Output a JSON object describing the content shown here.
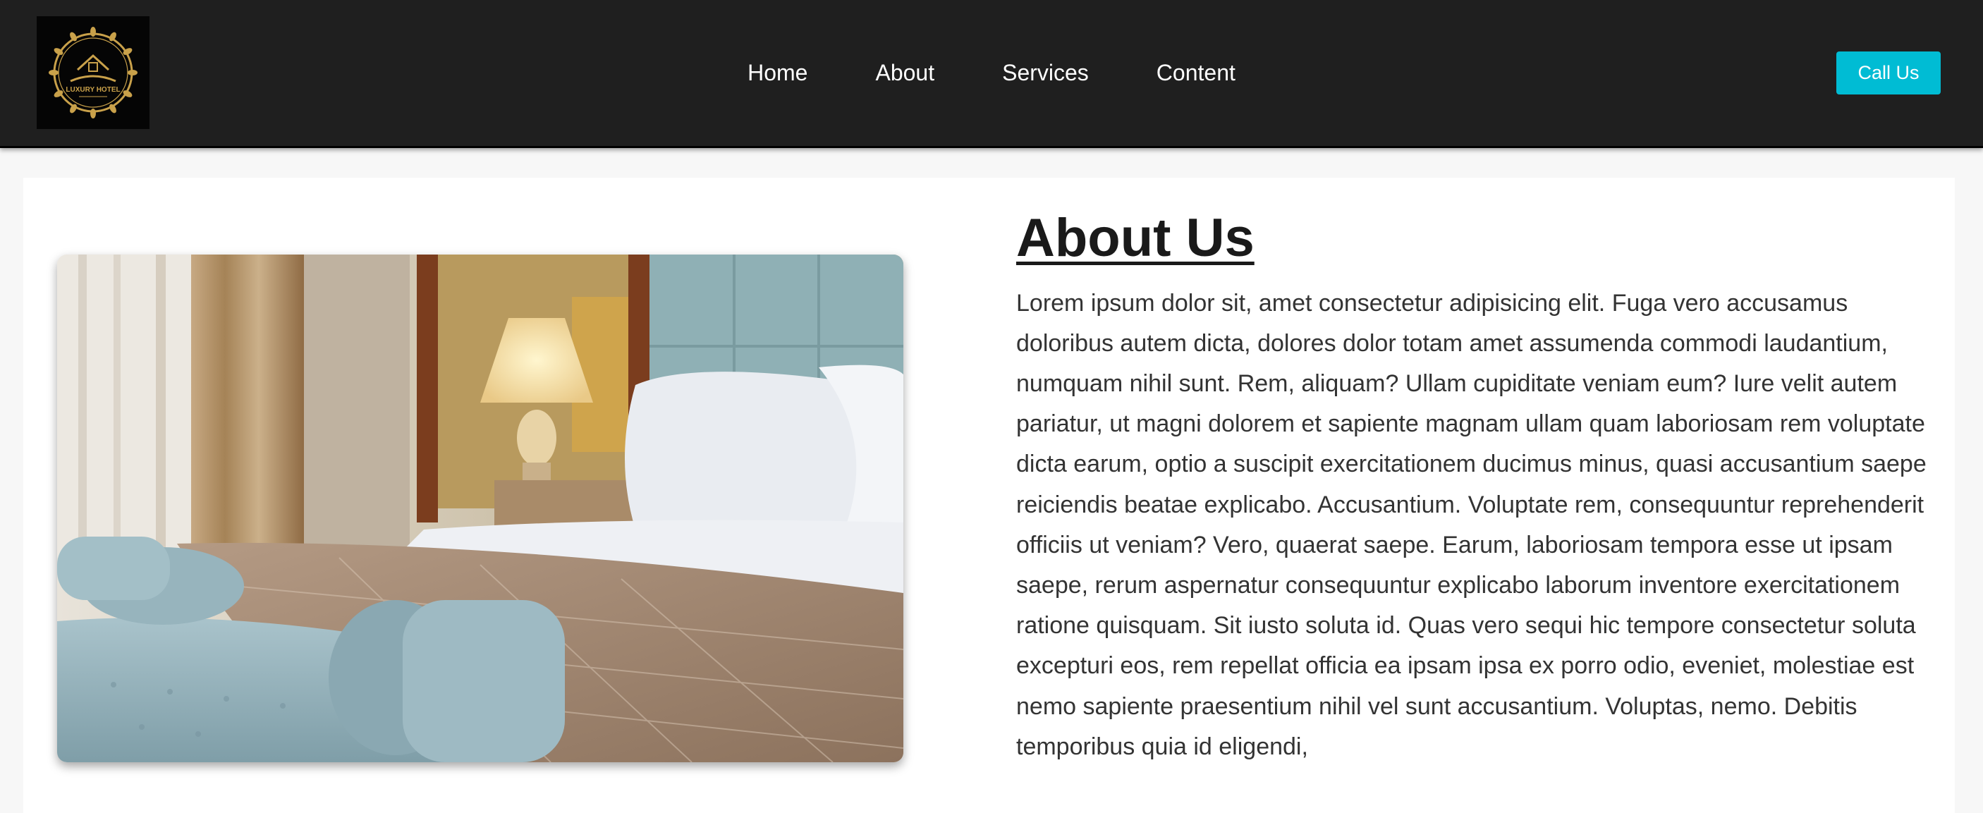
{
  "brand": {
    "logo_text": "LUXURY HOTEL",
    "logo_icon": "house-wreath-icon"
  },
  "nav": {
    "items": [
      {
        "label": "Home"
      },
      {
        "label": "About"
      },
      {
        "label": "Services"
      },
      {
        "label": "Content"
      }
    ],
    "call_button": "Call Us"
  },
  "about": {
    "title": "About Us",
    "body": "Lorem ipsum dolor sit, amet consectetur adipisicing elit. Fuga vero accusamus doloribus autem dicta, dolores dolor totam amet assumenda commodi laudantium, numquam nihil sunt. Rem, aliquam? Ullam cupiditate veniam eum? Iure velit autem pariatur, ut magni dolorem et sapiente magnam ullam quam laboriosam rem voluptate dicta earum, optio a suscipit exercitationem ducimus minus, quasi accusantium saepe reiciendis beatae explicabo. Accusantium. Voluptate rem, consequuntur reprehenderit officiis ut veniam? Vero, quaerat saepe. Earum, laboriosam tempora esse ut ipsam saepe, rerum aspernatur consequuntur explicabo laborum inventore exercitationem ratione quisquam. Sit iusto soluta id. Quas vero sequi hic tempore consectetur soluta excepturi eos, rem repellat officia ea ipsam ipsa ex porro odio, eveniet, molestiae est nemo sapiente praesentium nihil vel sunt accusantium. Voluptas, nemo. Debitis temporibus quia id eligendi,",
    "image_subject": "hotel-bedroom-photo"
  },
  "colors": {
    "navbar_bg": "#1f1f1f",
    "accent": "#00bcd4",
    "logo_gold": "#c9a14a",
    "page_bg": "#f7f7f7"
  }
}
